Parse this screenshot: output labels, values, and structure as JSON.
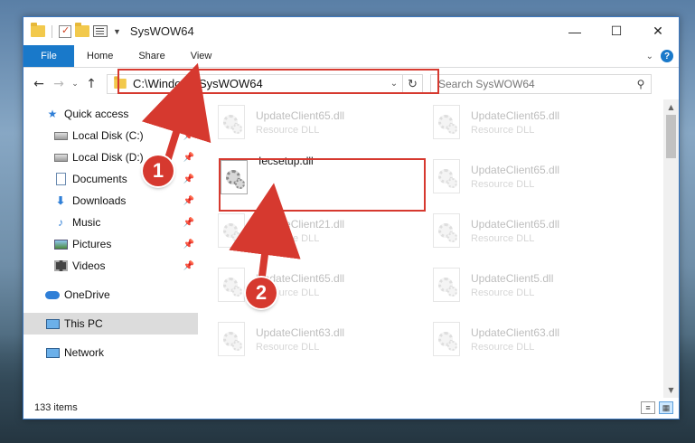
{
  "window": {
    "title": "SysWOW64",
    "controls": {
      "minimize": "—",
      "maximize": "☐",
      "close": "✕"
    }
  },
  "ribbon": {
    "tabs": [
      "File",
      "Home",
      "Share",
      "View"
    ]
  },
  "address_bar": {
    "path": "C:\\Windows\\SysWOW64",
    "search_placeholder": "Search SysWOW64"
  },
  "nav": {
    "quick_access": "Quick access",
    "items": [
      {
        "label": "Local Disk (C:)",
        "icon": "disk-icon"
      },
      {
        "label": "Local Disk (D:)",
        "icon": "disk-icon"
      },
      {
        "label": "Documents",
        "icon": "documents-icon"
      },
      {
        "label": "Downloads",
        "icon": "downloads-icon"
      },
      {
        "label": "Music",
        "icon": "music-icon"
      },
      {
        "label": "Pictures",
        "icon": "pictures-icon"
      },
      {
        "label": "Videos",
        "icon": "videos-icon"
      }
    ],
    "onedrive": "OneDrive",
    "this_pc": "This PC",
    "network": "Network"
  },
  "files": {
    "highlighted": {
      "name": "Iecsetup.dll"
    },
    "ghost": [
      {
        "name": "UpdateClient65.dll",
        "type": "Resource DLL"
      },
      {
        "name": "UpdateClient65.dll",
        "type": "Resource DLL"
      },
      {
        "name": "UpdateClient65.dll",
        "type": "Resource DLL"
      },
      {
        "name": "UpdateClient21.dll",
        "type": "Resource DLL"
      },
      {
        "name": "UpdateClient65.dll",
        "type": "Resource DLL"
      },
      {
        "name": "UpdateClient65.dll",
        "type": "Resource DLL"
      },
      {
        "name": "UpdateClient5.dll",
        "type": "Resource DLL"
      },
      {
        "name": "UpdateClient63.dll",
        "type": "Resource DLL"
      },
      {
        "name": "UpdateClient63.dll",
        "type": "Resource DLL"
      }
    ]
  },
  "status": {
    "item_count": "133 items"
  },
  "callouts": {
    "one": "1",
    "two": "2"
  },
  "colors": {
    "accent": "#1979ca",
    "highlight_red": "#d6392f"
  }
}
